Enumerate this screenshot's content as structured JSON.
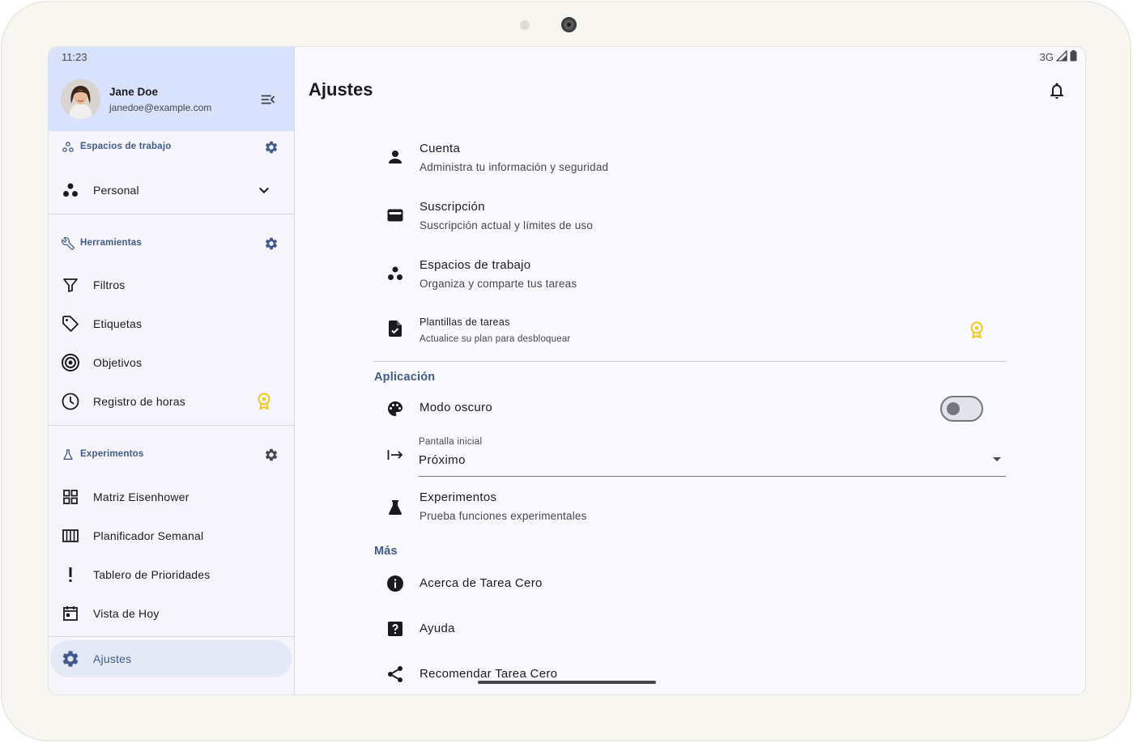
{
  "status_bar": {
    "time": "11:23",
    "network": "3G"
  },
  "profile": {
    "name": "Jane Doe",
    "email": "janedoe@example.com"
  },
  "sidebar": {
    "workspaces": {
      "header": "Espacios de trabajo",
      "selected": "Personal"
    },
    "tools": {
      "header": "Herramientas",
      "items": [
        {
          "label": "Filtros",
          "icon": "filter-icon"
        },
        {
          "label": "Etiquetas",
          "icon": "tag-icon"
        },
        {
          "label": "Objetivos",
          "icon": "target-icon"
        },
        {
          "label": "Registro de horas",
          "icon": "clock-icon",
          "premium": true
        }
      ]
    },
    "experiments": {
      "header": "Experimentos",
      "items": [
        {
          "label": "Matriz Eisenhower",
          "icon": "grid-icon"
        },
        {
          "label": "Planificador Semanal",
          "icon": "columns-icon"
        },
        {
          "label": "Tablero de Prioridades",
          "icon": "exclamation-icon"
        },
        {
          "label": "Vista de Hoy",
          "icon": "calendar-icon"
        }
      ]
    },
    "settings_label": "Ajustes"
  },
  "main": {
    "title": "Ajustes",
    "account_rows": [
      {
        "title": "Cuenta",
        "subtitle": "Administra tu información y seguridad",
        "icon": "person-icon"
      },
      {
        "title": "Suscripción",
        "subtitle": "Suscripción actual y límites de uso",
        "icon": "wallet-icon"
      },
      {
        "title": "Espacios de trabajo",
        "subtitle": "Organiza y comparte tus tareas",
        "icon": "workspaces-icon"
      },
      {
        "title": "Plantillas de tareas",
        "subtitle": "Actualice su plan para desbloquear",
        "icon": "task-template-icon",
        "premium": true
      }
    ],
    "app_section": {
      "title": "Aplicación",
      "dark_mode_label": "Modo oscuro",
      "dark_mode_on": false,
      "start_screen_label": "Pantalla inicial",
      "start_screen_value": "Próximo",
      "experiments_title": "Experimentos",
      "experiments_subtitle": "Prueba funciones experimentales"
    },
    "more_section": {
      "title": "Más",
      "items": [
        {
          "label": "Acerca de Tarea Cero",
          "icon": "info-icon"
        },
        {
          "label": "Ayuda",
          "icon": "help-icon"
        },
        {
          "label": "Recomendar Tarea Cero",
          "icon": "share-icon"
        }
      ]
    }
  },
  "colors": {
    "accent": "#3f5a8d",
    "sidebar_header_bg": "#d8e2fc",
    "premium_badge": "#f5c518"
  }
}
